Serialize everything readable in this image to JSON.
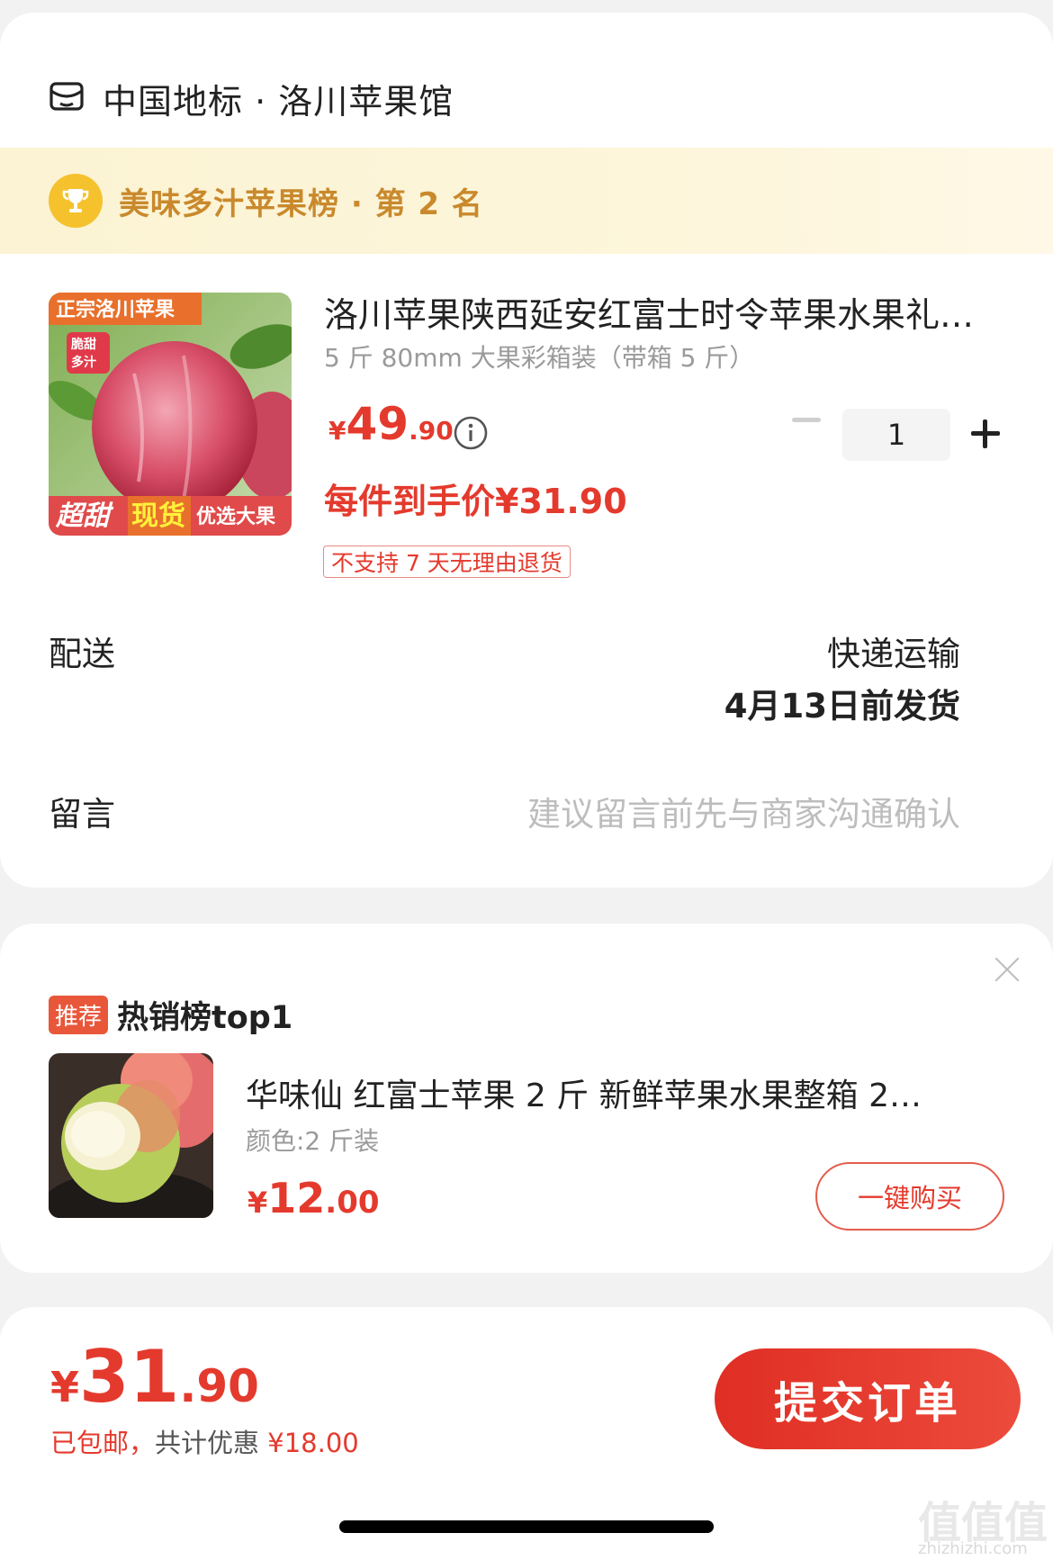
{
  "shop": {
    "name": "中国地标 · 洛川苹果馆",
    "icon": "shop-icon"
  },
  "ranking": {
    "text": "美味多汁苹果榜 · 第 2 名",
    "icon": "trophy-icon"
  },
  "product": {
    "image_overlay": {
      "top": "正宗洛川苹果",
      "badge": "脆甜多汁",
      "bottom_a": "超甜",
      "bottom_b": "现货",
      "bottom_c": "优选大果"
    },
    "title": "洛川苹果陕西延安红富士时令苹果水果礼…",
    "spec": "5 斤 80mm 大果彩箱装（带箱 5 斤）",
    "price": {
      "currency": "¥",
      "integer": "49",
      "decimal": ".90"
    },
    "final_price": "每件到手价¥31.90",
    "tag": "不支持 7 天无理由退货",
    "quantity": "1"
  },
  "delivery": {
    "label": "配送",
    "method": "快递运输",
    "ship_date": "4月13日前发货"
  },
  "message": {
    "label": "留言",
    "placeholder": "建议留言前先与商家沟通确认"
  },
  "recommend": {
    "badge": "推荐",
    "title": "热销榜top1",
    "item_name": "华味仙 红富士苹果 2 斤 新鲜苹果水果整箱 2…",
    "item_spec": "颜色:2 斤装",
    "price": {
      "currency": "¥",
      "integer": "12",
      "decimal": ".00"
    },
    "buy_label": "一键购买"
  },
  "footer": {
    "total": {
      "currency": "¥",
      "integer": "31",
      "decimal": ".90"
    },
    "shipping_note": "已包邮，",
    "discount_label": "共计优惠",
    "discount_value": "¥18.00",
    "submit_label": "提交订单"
  },
  "watermark": {
    "text": "值值值",
    "sub": "zhizhizhi.com"
  },
  "colors": {
    "accent": "#e43a2d",
    "rank_text": "#c9892c",
    "rank_bg": "#fbf3d3",
    "trophy": "#f5c22e"
  }
}
